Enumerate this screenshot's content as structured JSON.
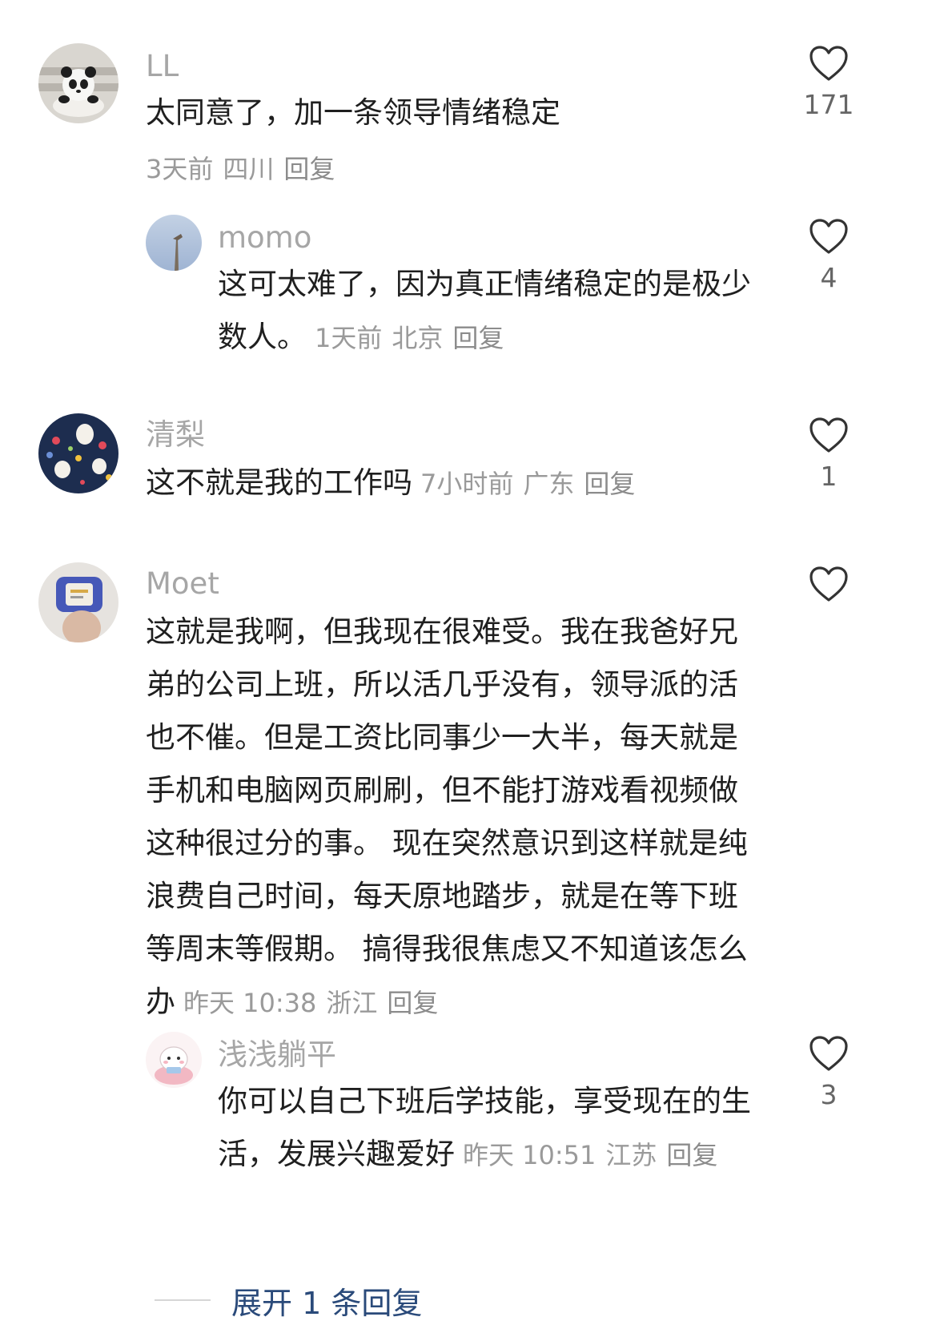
{
  "comments": [
    {
      "author": "LL",
      "text": "太同意了，加一条领导情绪稳定",
      "time": "3天前",
      "location": "四川",
      "reply_label": "回复",
      "likes": "171"
    },
    {
      "author": "momo",
      "text": "这可太难了，因为真正情绪稳定的是极少数人。",
      "time": "1天前",
      "location": "北京",
      "reply_label": "回复",
      "likes": "4"
    },
    {
      "author": "清梨",
      "text": "这不就是我的工作吗",
      "time": "7小时前",
      "location": "广东",
      "reply_label": "回复",
      "likes": "1"
    },
    {
      "author": "Moet",
      "text": "这就是我啊，但我现在很难受。我在我爸好兄弟的公司上班，所以活几乎没有，领导派的活也不催。但是工资比同事少一大半，每天就是手机和电脑网页刷刷，但不能打游戏看视频做这种很过分的事。 现在突然意识到这样就是纯浪费自己时间，每天原地踏步，就是在等下班等周末等假期。 搞得我很焦虑又不知道该怎么办",
      "time": "昨天 10:38",
      "location": "浙江",
      "reply_label": "回复",
      "likes": ""
    },
    {
      "author": "浅浅躺平",
      "text": "你可以自己下班后学技能，享受现在的生活，发展兴趣爱好",
      "time": "昨天 10:51",
      "location": "江苏",
      "reply_label": "回复",
      "likes": "3"
    }
  ],
  "expand_label": "展开 1 条回复",
  "icons": {
    "like": "heart-outline-icon"
  },
  "colors": {
    "author": "#a6a6a6",
    "meta": "#9a9a9a",
    "expand": "#2a4a7a"
  }
}
